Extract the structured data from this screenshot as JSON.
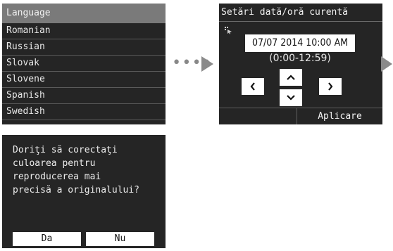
{
  "language_screen": {
    "title": "Language",
    "items": [
      "Romanian",
      "Russian",
      "Slovak",
      "Slovene",
      "Spanish",
      "Swedish"
    ]
  },
  "arrows": {
    "dots": "••••"
  },
  "date_screen": {
    "title": "Setări dată/oră curentă",
    "value": "07/07 2014 10:00 AM",
    "range": "(0:00-12:59)",
    "up_label": "^",
    "down_label": "v",
    "left_label": "<",
    "right_label": ">",
    "apply_label": "Aplicare"
  },
  "confirm_screen": {
    "message": "Doriţi să corectaţi\nculoarea pentru\nreproducerea mai\nprecisă a originalului?",
    "yes_label": "Da",
    "no_label": "Nu"
  },
  "colors": {
    "screen_bg": "#252525",
    "title_bar": "#7a7a7a",
    "arrow": "#8a8a8a"
  }
}
